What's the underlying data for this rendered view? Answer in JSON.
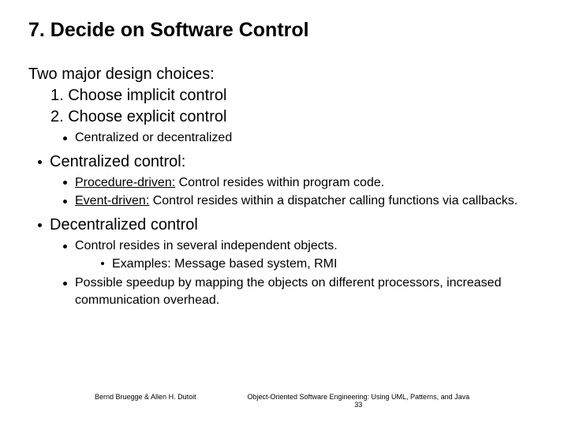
{
  "title": "7. Decide on Software Control",
  "intro": {
    "lead": "Two major design choices:",
    "choice1": "1. Choose implicit  control",
    "choice2": "2. Choose explicit control"
  },
  "explicit_sub": "Centralized or decentralized",
  "centralized": {
    "heading": "Centralized control:",
    "proc_label": "Procedure-driven:",
    "proc_text": " Control resides within program code.",
    "event_label": "Event-driven:",
    "event_text": " Control resides within a dispatcher calling functions via callbacks."
  },
  "decentralized": {
    "heading": "Decentralized control",
    "line1": "Control resides in several independent objects.",
    "examples": "Examples: Message based system, RMI",
    "line2": "Possible speedup by mapping the objects on different processors, increased communication overhead."
  },
  "footer": {
    "authors": "Bernd Bruegge & Allen H. Dutoit",
    "book": "Object-Oriented Software Engineering: Using UML, Patterns, and Java",
    "page": "33"
  }
}
